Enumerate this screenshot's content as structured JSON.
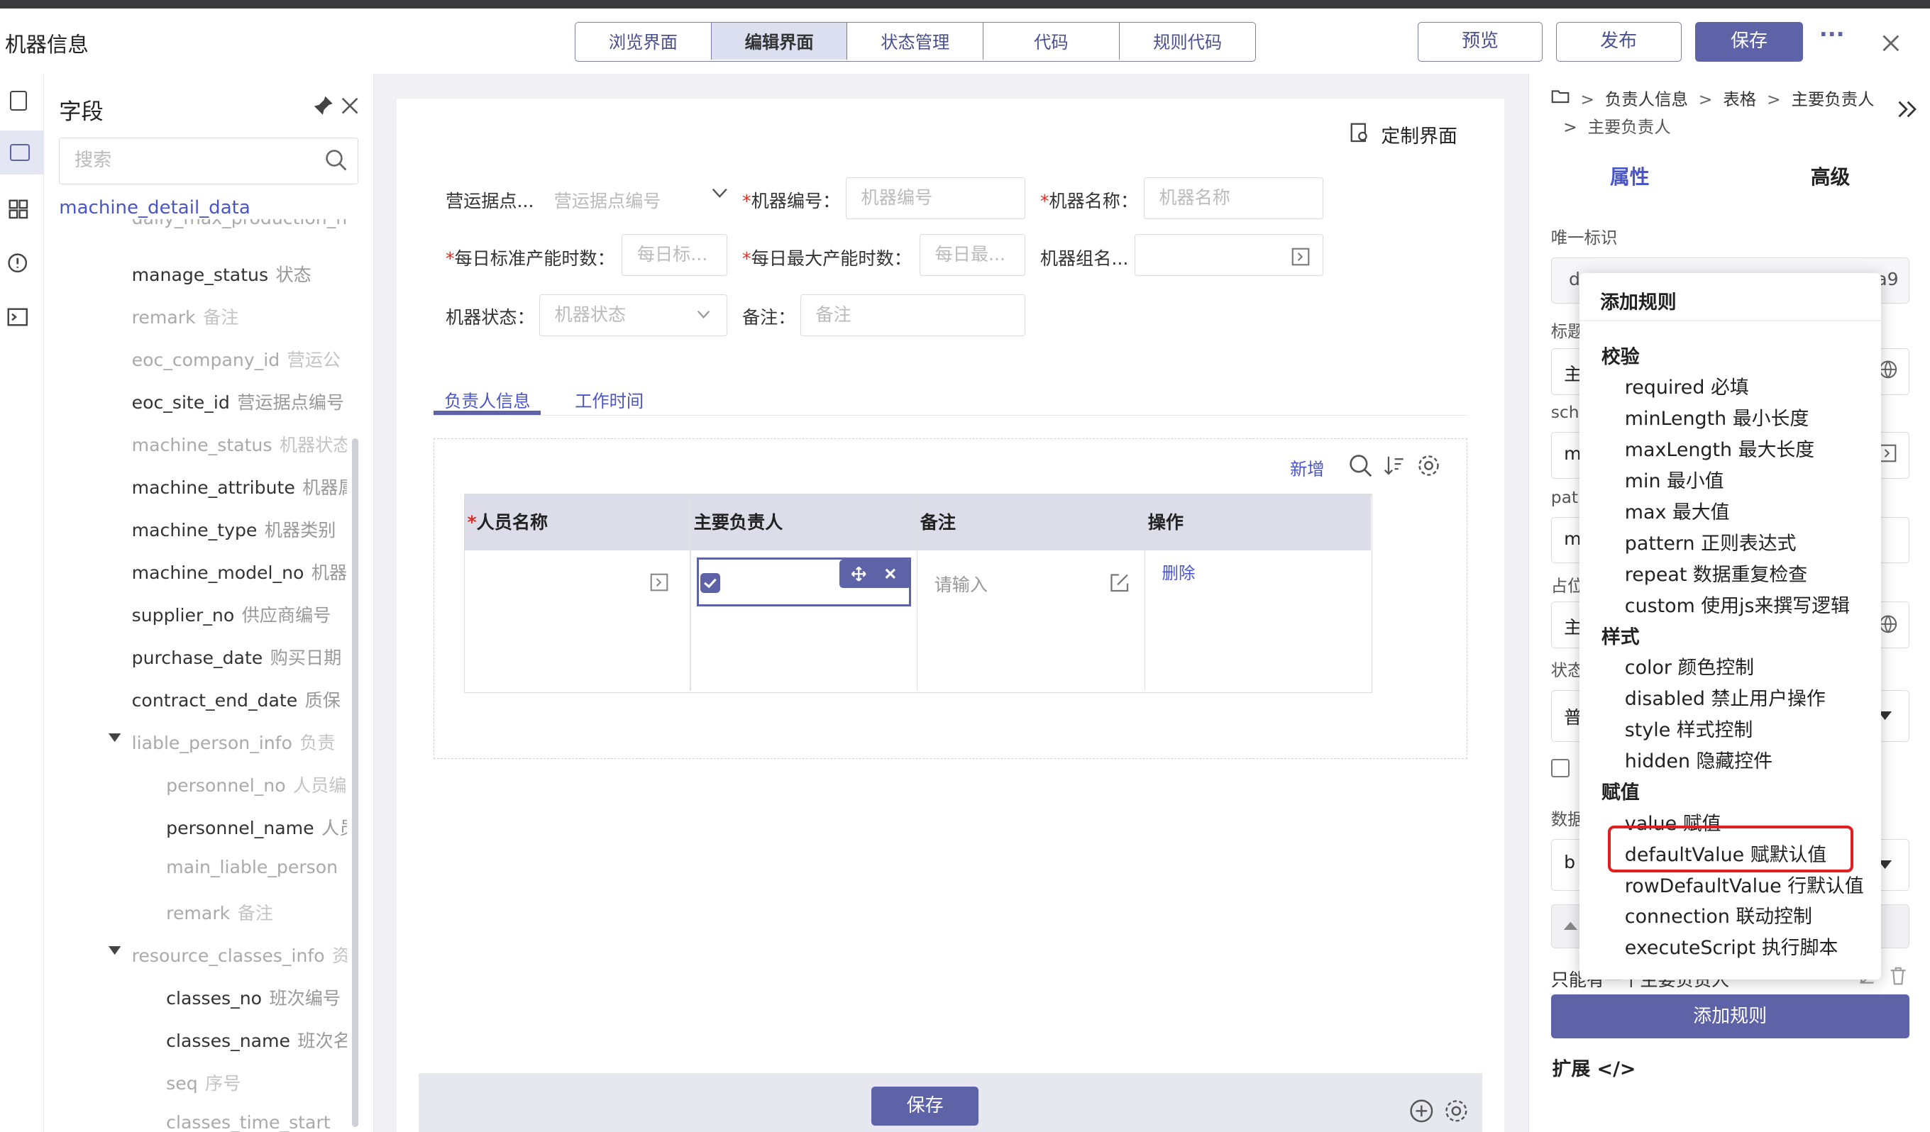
{
  "header": {
    "title": "机器信息",
    "tabs": [
      "浏览界面",
      "编辑界面",
      "状态管理",
      "代码",
      "规则代码"
    ],
    "active_tab": "编辑界面",
    "preview_label": "预览",
    "publish_label": "发布",
    "save_label": "保存",
    "more_label": "···"
  },
  "field_panel": {
    "title": "字段",
    "search_placeholder": "搜索",
    "root": "machine_detail_data",
    "partial_top": "daily_max_production_h",
    "items": [
      {
        "name": "manage_status",
        "label": "状态",
        "dim": false
      },
      {
        "name": "remark",
        "label": "备注",
        "dim": true
      },
      {
        "name": "eoc_company_id",
        "label": "营运公",
        "dim": true
      },
      {
        "name": "eoc_site_id",
        "label": "营运据点编号",
        "dim": false
      },
      {
        "name": "machine_status",
        "label": "机器状态",
        "dim": true
      },
      {
        "name": "machine_attribute",
        "label": "机器属",
        "dim": false
      },
      {
        "name": "machine_type",
        "label": "机器类别",
        "dim": false
      },
      {
        "name": "machine_model_no",
        "label": "机器",
        "dim": false
      },
      {
        "name": "supplier_no",
        "label": "供应商编号",
        "dim": false
      },
      {
        "name": "purchase_date",
        "label": "购买日期",
        "dim": false
      },
      {
        "name": "contract_end_date",
        "label": "质保",
        "dim": false
      },
      {
        "name": "liable_person_info",
        "label": "负责",
        "dim": true
      },
      {
        "name": "personnel_no",
        "label": "人员编",
        "dim": true
      },
      {
        "name": "personnel_name",
        "label": "人员",
        "dim": false
      },
      {
        "name": "main_liable_person",
        "label": "",
        "dim": true
      },
      {
        "name": "remark",
        "label": "备注",
        "dim": true
      },
      {
        "name": "resource_classes_info",
        "label": "资",
        "dim": true
      },
      {
        "name": "classes_no",
        "label": "班次编号",
        "dim": false
      },
      {
        "name": "classes_name",
        "label": "班次名",
        "dim": false
      },
      {
        "name": "seq",
        "label": "序号",
        "dim": true
      },
      {
        "name": "classes_time_start",
        "label": "",
        "dim": true
      }
    ]
  },
  "canvas": {
    "customize_label": "定制界面",
    "form": {
      "site_label": "营运据点...",
      "site_placeholder": "营运据点编号",
      "machine_no_label": "机器编号：",
      "machine_no_placeholder": "机器编号",
      "machine_name_label": "机器名称：",
      "machine_name_placeholder": "机器名称",
      "daily_std_label": "每日标准产能时数：",
      "daily_std_placeholder": "每日标...",
      "daily_max_label": "每日最大产能时数：",
      "daily_max_placeholder": "每日最...",
      "group_label": "机器组名...",
      "status_label": "机器状态：",
      "status_placeholder": "机器状态",
      "remark_label": "备注：",
      "remark_placeholder": "备注"
    },
    "subtabs": [
      "负责人信息",
      "工作时间"
    ],
    "active_subtab": "负责人信息",
    "add_label": "新增",
    "table": {
      "columns": [
        "人员名称",
        "主要负责人",
        "备注",
        "操作"
      ],
      "row": {
        "remark_placeholder": "请输入",
        "action": "删除"
      }
    },
    "bottom_save": "保存"
  },
  "right_panel": {
    "breadcrumb": [
      "负责人信息",
      "表格",
      "主要负责人"
    ],
    "breadcrumb_line2": "主要负责人",
    "tabs": [
      "属性",
      "高级"
    ],
    "active_tab": "属性",
    "unique_id_label": "唯一标识",
    "unique_id_value_left": "d",
    "unique_id_value_right": "a9",
    "side_labels": [
      "标题",
      "sch",
      "pat",
      "占位",
      "状态",
      "数据"
    ],
    "side_values": [
      "主",
      "m",
      "m",
      "主",
      "普",
      "b"
    ],
    "bottom_text": "只能有一个主要负责人",
    "add_rule_button": "添加规则",
    "extend_label": "扩展 </>"
  },
  "add_rule_popup": {
    "title": "添加规则",
    "groups": [
      {
        "heading": "校验",
        "items": [
          "required 必填",
          "minLength 最小长度",
          "maxLength 最大长度",
          "min 最小值",
          "max 最大值",
          "pattern 正则表达式",
          "repeat 数据重复检查",
          "custom 使用js来撰写逻辑"
        ]
      },
      {
        "heading": "样式",
        "items": [
          "color 颜色控制",
          "disabled 禁止用户操作",
          "style 样式控制",
          "hidden 隐藏控件"
        ]
      },
      {
        "heading": "赋值",
        "items": [
          "value 赋值",
          "defaultValue 赋默认值",
          "rowDefaultValue 行默认值",
          "connection 联动控制",
          "executeScript 执行脚本"
        ]
      }
    ],
    "highlighted": "defaultValue 赋默认值"
  },
  "colors": {
    "accent": "#5e63a8",
    "highlight": "#e02020",
    "link": "#4a55c8"
  }
}
